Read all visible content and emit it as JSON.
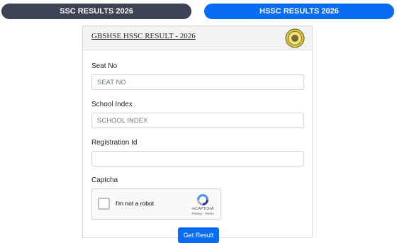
{
  "tabs": {
    "ssc_label": "SSC RESULTS 2026",
    "hssc_label": "HSSC RESULTS 2026",
    "active": "hssc"
  },
  "card": {
    "title": "GBSHSE HSSC RESULT - 2026"
  },
  "form": {
    "seat_no_label": "Seat No",
    "seat_no_placeholder": "SEAT NO",
    "school_index_label": "School Index",
    "school_index_placeholder": "SCHOOL INDEX",
    "registration_label": "Registration Id",
    "registration_placeholder": "",
    "captcha_label": "Captcha",
    "submit_label": "Get Result"
  },
  "captcha": {
    "checkbox_text": "I'm not a robot",
    "brand": "reCAPTCHA",
    "links": "Privacy - Terms"
  },
  "colors": {
    "ssc_tab": "#3d4255",
    "hssc_tab": "#0a6cf5"
  }
}
